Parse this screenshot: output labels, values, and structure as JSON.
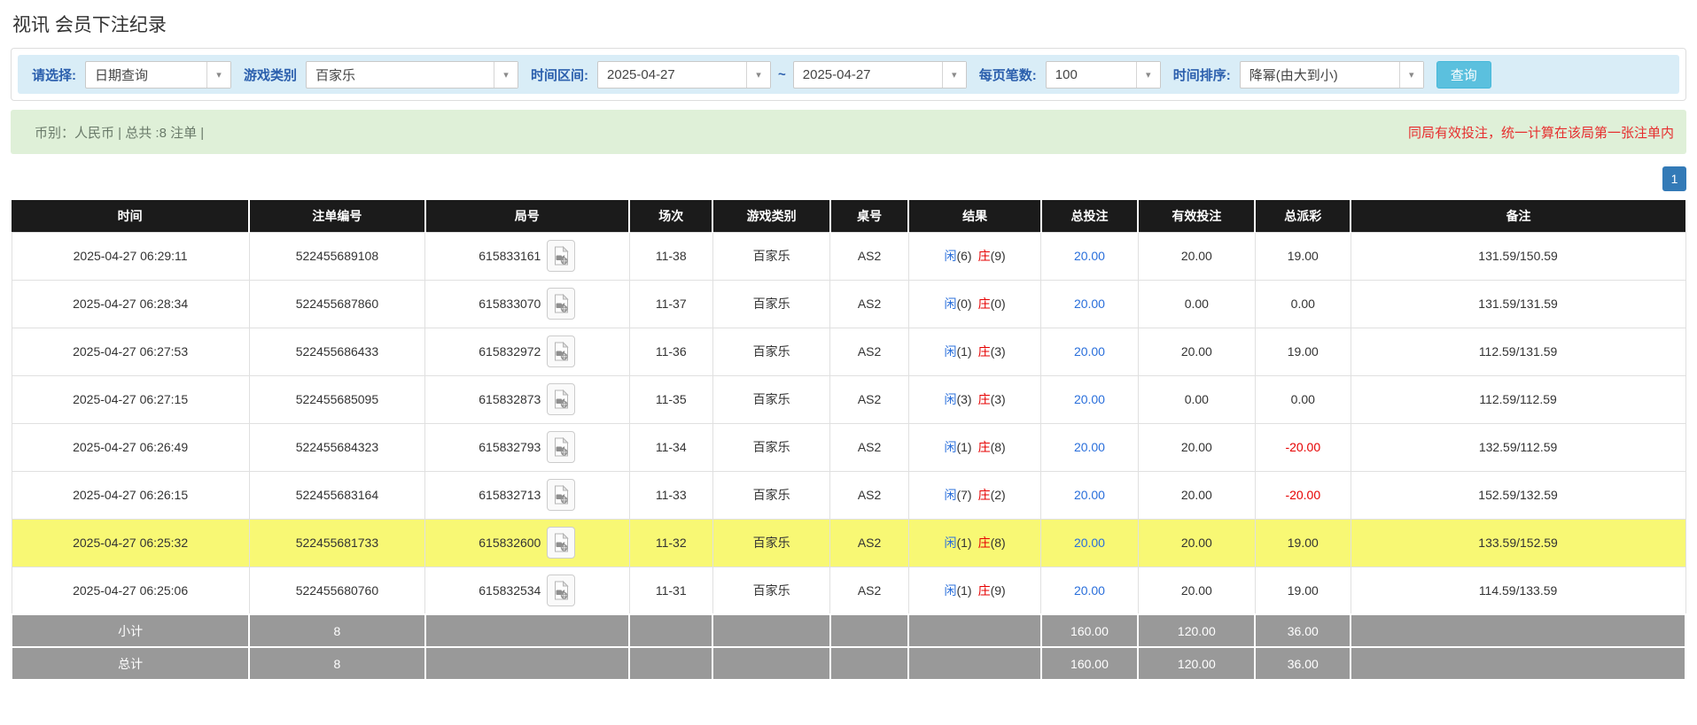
{
  "page": {
    "title": "视讯 会员下注纪录"
  },
  "filters": {
    "query_label": "请选择:",
    "query_value": "日期查询",
    "game_label": "游戏类别",
    "game_value": "百家乐",
    "range_label": "时间区间:",
    "date_from": "2025-04-27",
    "tilde": "~",
    "date_to": "2025-04-27",
    "perpage_label": "每页笔数:",
    "perpage_value": "100",
    "sort_label": "时间排序:",
    "sort_value": "降幂(由大到小)",
    "search_button": "查询"
  },
  "notice": {
    "left": "币别：人民币 | 总共 :8 注单 |",
    "right": "同局有效投注，统一计算在该局第一张注单内"
  },
  "pagination": {
    "page": "1"
  },
  "table": {
    "headers": [
      "时间",
      "注单编号",
      "局号",
      "场次",
      "游戏类别",
      "桌号",
      "结果",
      "总投注",
      "有效投注",
      "总派彩",
      "备注"
    ],
    "rows": [
      {
        "time": "2025-04-27 06:29:11",
        "bet_id": "522455689108",
        "round_id": "615833161",
        "session": "11-38",
        "game": "百家乐",
        "table_no": "AS2",
        "player": "闲",
        "player_n": "(6)",
        "banker": "庄",
        "banker_n": "(9)",
        "total_bet": "20.00",
        "valid_bet": "20.00",
        "payout": "19.00",
        "remark": "131.59/150.59",
        "highlighted": false
      },
      {
        "time": "2025-04-27 06:28:34",
        "bet_id": "522455687860",
        "round_id": "615833070",
        "session": "11-37",
        "game": "百家乐",
        "table_no": "AS2",
        "player": "闲",
        "player_n": "(0)",
        "banker": "庄",
        "banker_n": "(0)",
        "total_bet": "20.00",
        "valid_bet": "0.00",
        "payout": "0.00",
        "remark": "131.59/131.59",
        "highlighted": false
      },
      {
        "time": "2025-04-27 06:27:53",
        "bet_id": "522455686433",
        "round_id": "615832972",
        "session": "11-36",
        "game": "百家乐",
        "table_no": "AS2",
        "player": "闲",
        "player_n": "(1)",
        "banker": "庄",
        "banker_n": "(3)",
        "total_bet": "20.00",
        "valid_bet": "20.00",
        "payout": "19.00",
        "remark": "112.59/131.59",
        "highlighted": false
      },
      {
        "time": "2025-04-27 06:27:15",
        "bet_id": "522455685095",
        "round_id": "615832873",
        "session": "11-35",
        "game": "百家乐",
        "table_no": "AS2",
        "player": "闲",
        "player_n": "(3)",
        "banker": "庄",
        "banker_n": "(3)",
        "total_bet": "20.00",
        "valid_bet": "0.00",
        "payout": "0.00",
        "remark": "112.59/112.59",
        "highlighted": false
      },
      {
        "time": "2025-04-27 06:26:49",
        "bet_id": "522455684323",
        "round_id": "615832793",
        "session": "11-34",
        "game": "百家乐",
        "table_no": "AS2",
        "player": "闲",
        "player_n": "(1)",
        "banker": "庄",
        "banker_n": "(8)",
        "total_bet": "20.00",
        "valid_bet": "20.00",
        "payout": "-20.00",
        "remark": "132.59/112.59",
        "highlighted": false
      },
      {
        "time": "2025-04-27 06:26:15",
        "bet_id": "522455683164",
        "round_id": "615832713",
        "session": "11-33",
        "game": "百家乐",
        "table_no": "AS2",
        "player": "闲",
        "player_n": "(7)",
        "banker": "庄",
        "banker_n": "(2)",
        "total_bet": "20.00",
        "valid_bet": "20.00",
        "payout": "-20.00",
        "remark": "152.59/132.59",
        "highlighted": false
      },
      {
        "time": "2025-04-27 06:25:32",
        "bet_id": "522455681733",
        "round_id": "615832600",
        "session": "11-32",
        "game": "百家乐",
        "table_no": "AS2",
        "player": "闲",
        "player_n": "(1)",
        "banker": "庄",
        "banker_n": "(8)",
        "total_bet": "20.00",
        "valid_bet": "20.00",
        "payout": "19.00",
        "remark": "133.59/152.59",
        "highlighted": true
      },
      {
        "time": "2025-04-27 06:25:06",
        "bet_id": "522455680760",
        "round_id": "615832534",
        "session": "11-31",
        "game": "百家乐",
        "table_no": "AS2",
        "player": "闲",
        "player_n": "(1)",
        "banker": "庄",
        "banker_n": "(9)",
        "total_bet": "20.00",
        "valid_bet": "20.00",
        "payout": "19.00",
        "remark": "114.59/133.59",
        "highlighted": false
      }
    ],
    "subtotal": {
      "label": "小计",
      "count": "8",
      "total_bet": "160.00",
      "valid_bet": "120.00",
      "payout": "36.00"
    },
    "total": {
      "label": "总计",
      "count": "8",
      "total_bet": "160.00",
      "valid_bet": "120.00",
      "payout": "36.00"
    }
  },
  "colors": {
    "header_bg": "#1b1b1b",
    "highlight_row": "#f8f874",
    "link_blue": "#2a6fdb",
    "negative_red": "#e60000",
    "footer_gray": "#999999",
    "filter_bar_bg": "#d9edf7",
    "notice_bg": "#dff0d8",
    "search_button_bg": "#5bc0de",
    "pagination_bg": "#337ab7"
  }
}
